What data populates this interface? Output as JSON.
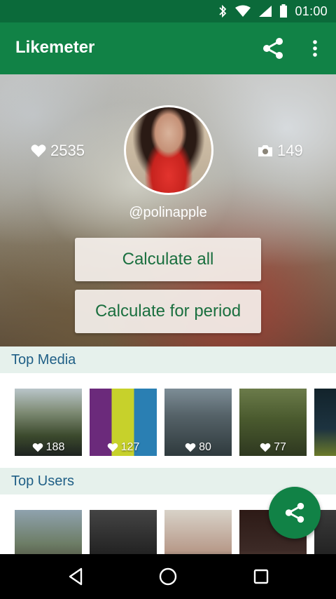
{
  "status_bar": {
    "time": "01:00",
    "icons": [
      "bluetooth-icon",
      "wifi-icon",
      "signal-icon",
      "battery-icon"
    ]
  },
  "app_bar": {
    "title": "Likemeter",
    "actions": [
      "share-icon",
      "more-vert-icon"
    ]
  },
  "profile": {
    "likes": "2535",
    "media_count": "149",
    "username": "@polinapple",
    "icons": {
      "likes": "heart-icon",
      "media": "camera-icon"
    }
  },
  "buttons": {
    "calculate_all": "Calculate all",
    "calculate_period": "Calculate for period"
  },
  "top_media": {
    "title": "Top Media",
    "items": [
      {
        "likes": "188"
      },
      {
        "likes": "127"
      },
      {
        "likes": "80"
      },
      {
        "likes": "77"
      }
    ]
  },
  "top_users": {
    "title": "Top Users"
  },
  "fab": {
    "icon": "share-icon"
  },
  "nav_bar": {
    "icons": [
      "back-icon",
      "home-icon",
      "recents-icon"
    ]
  },
  "colors": {
    "primary": "#118246",
    "primary_dark": "#0b6a3a",
    "button_text": "#1a6f3f",
    "section_bg": "#e6f1ec",
    "section_text": "#1f5f86"
  }
}
